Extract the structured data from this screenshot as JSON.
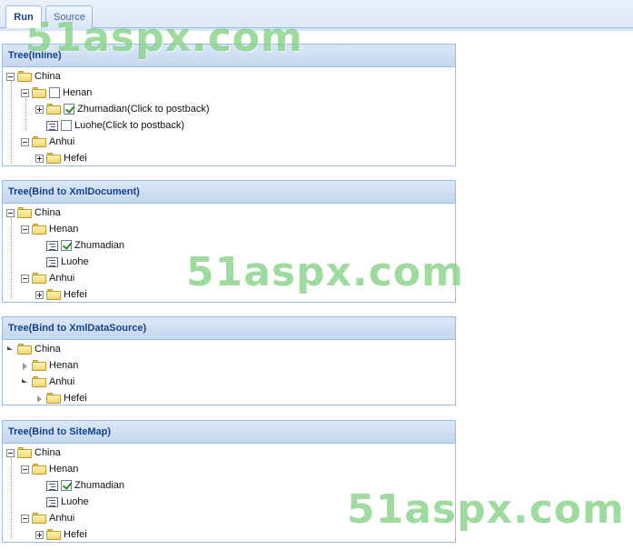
{
  "tabs": {
    "run": "Run",
    "source": "Source"
  },
  "watermark": "51aspx.com",
  "panels": [
    {
      "title": "Tree(Inline)",
      "china": "China",
      "henan": "Henan",
      "zhumadian": "Zhumadian(Click to postback)",
      "luohe": "Luohe(Click to postback)",
      "anhui": "Anhui",
      "hefei": "Hefei"
    },
    {
      "title": "Tree(Bind to XmlDocument)",
      "china": "China",
      "henan": "Henan",
      "zhumadian": "Zhumadian",
      "luohe": "Luohe",
      "anhui": "Anhui",
      "hefei": "Hefei"
    },
    {
      "title": "Tree(Bind to XmlDataSource)",
      "china": "China",
      "henan": "Henan",
      "anhui": "Anhui",
      "hefei": "Hefei"
    },
    {
      "title": "Tree(Bind to SiteMap)",
      "china": "China",
      "henan": "Henan",
      "zhumadian": "Zhumadian",
      "luohe": "Luohe",
      "anhui": "Anhui",
      "hefei": "Hefei"
    }
  ],
  "checked": {
    "inline_henan": false,
    "inline_zhumadian": true,
    "inline_luohe": false,
    "xmldoc_zhumadian": true,
    "sitemap_zhumadian": true
  },
  "colors": {
    "panel_header_text": "#15428b",
    "panel_border": "#99bbe8",
    "watermark": "#50be50"
  }
}
